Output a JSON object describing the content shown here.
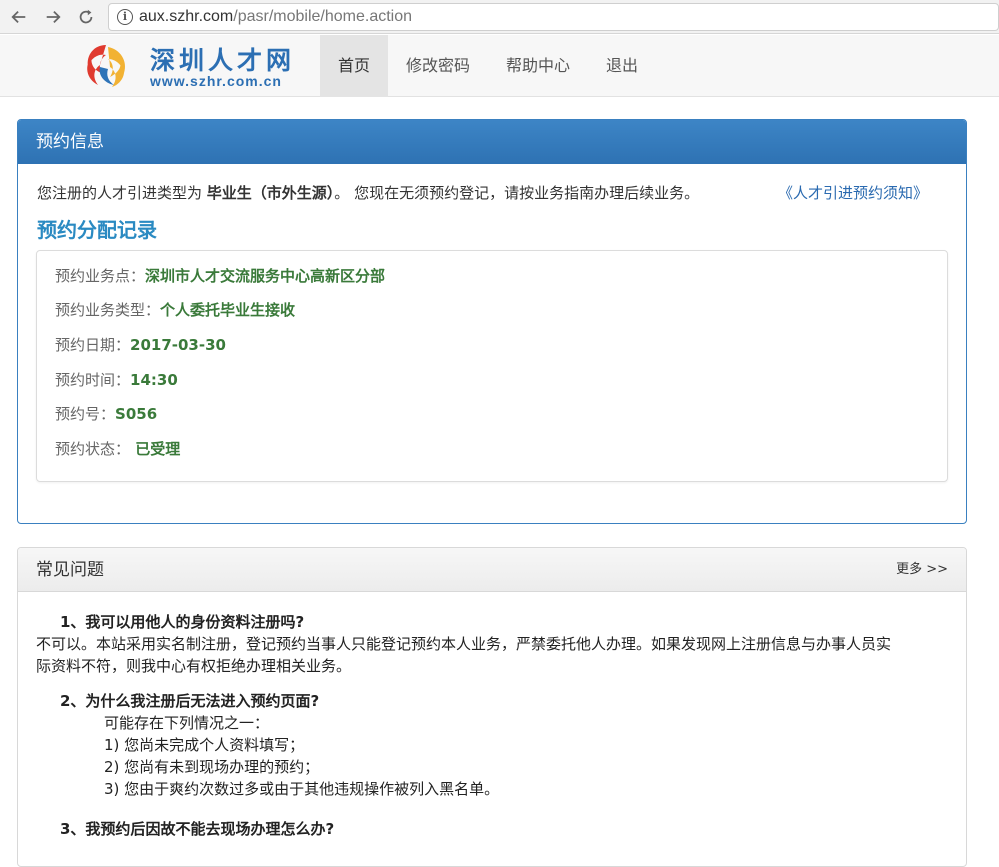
{
  "browser": {
    "url_host": "aux.szhr.com",
    "url_path": "/pasr/mobile/home.action",
    "back_icon": "arrow-left-icon",
    "forward_icon": "arrow-right-icon",
    "reload_icon": "reload-icon"
  },
  "header": {
    "logo_cn": "深圳人才网",
    "logo_en": "www.szhr.com.cn",
    "nav": [
      {
        "label": "首页",
        "active": true
      },
      {
        "label": "修改密码",
        "active": false
      },
      {
        "label": "帮助中心",
        "active": false
      },
      {
        "label": "退出",
        "active": false
      }
    ]
  },
  "booking": {
    "title": "预约信息",
    "notice_prefix": "您注册的人才引进类型为 ",
    "notice_type": "毕业生（市外生源）",
    "notice_suffix": "。 您现在无须预约登记，请按业务指南办理后续业务。",
    "notice_link": "《人才引进预约须知》",
    "records_title": "预约分配记录",
    "records": [
      {
        "label": "预约业务点：",
        "value": "深圳市人才交流服务中心高新区分部"
      },
      {
        "label": "预约业务类型：",
        "value": "个人委托毕业生接收"
      },
      {
        "label": "预约日期：",
        "value": "2017-03-30"
      },
      {
        "label": "预约时间：",
        "value": "14:30"
      },
      {
        "label": "预约号：",
        "value": "S056"
      },
      {
        "label": "预约状态：",
        "value": " 已受理"
      }
    ]
  },
  "faq": {
    "title": "常见问题",
    "more": "更多 >>",
    "items": [
      {
        "q": "1、我可以用他人的身份资料注册吗?",
        "a": "不可以。本站采用实名制注册，登记预约当事人只能登记预约本人业务，严禁委托他人办理。如果发现网上注册信息与办事人员实际资料不符，则我中心有权拒绝办理相关业务。"
      },
      {
        "q": "2、为什么我注册后无法进入预约页面?",
        "sub": [
          "可能存在下列情况之一：",
          "1) 您尚未完成个人资料填写；",
          "2) 您尚有未到现场办理的预约；",
          "3) 您由于爽约次数过多或由于其他违规操作被列入黑名单。"
        ]
      },
      {
        "q": "3、我预约后因故不能去现场办理怎么办?"
      }
    ]
  }
}
